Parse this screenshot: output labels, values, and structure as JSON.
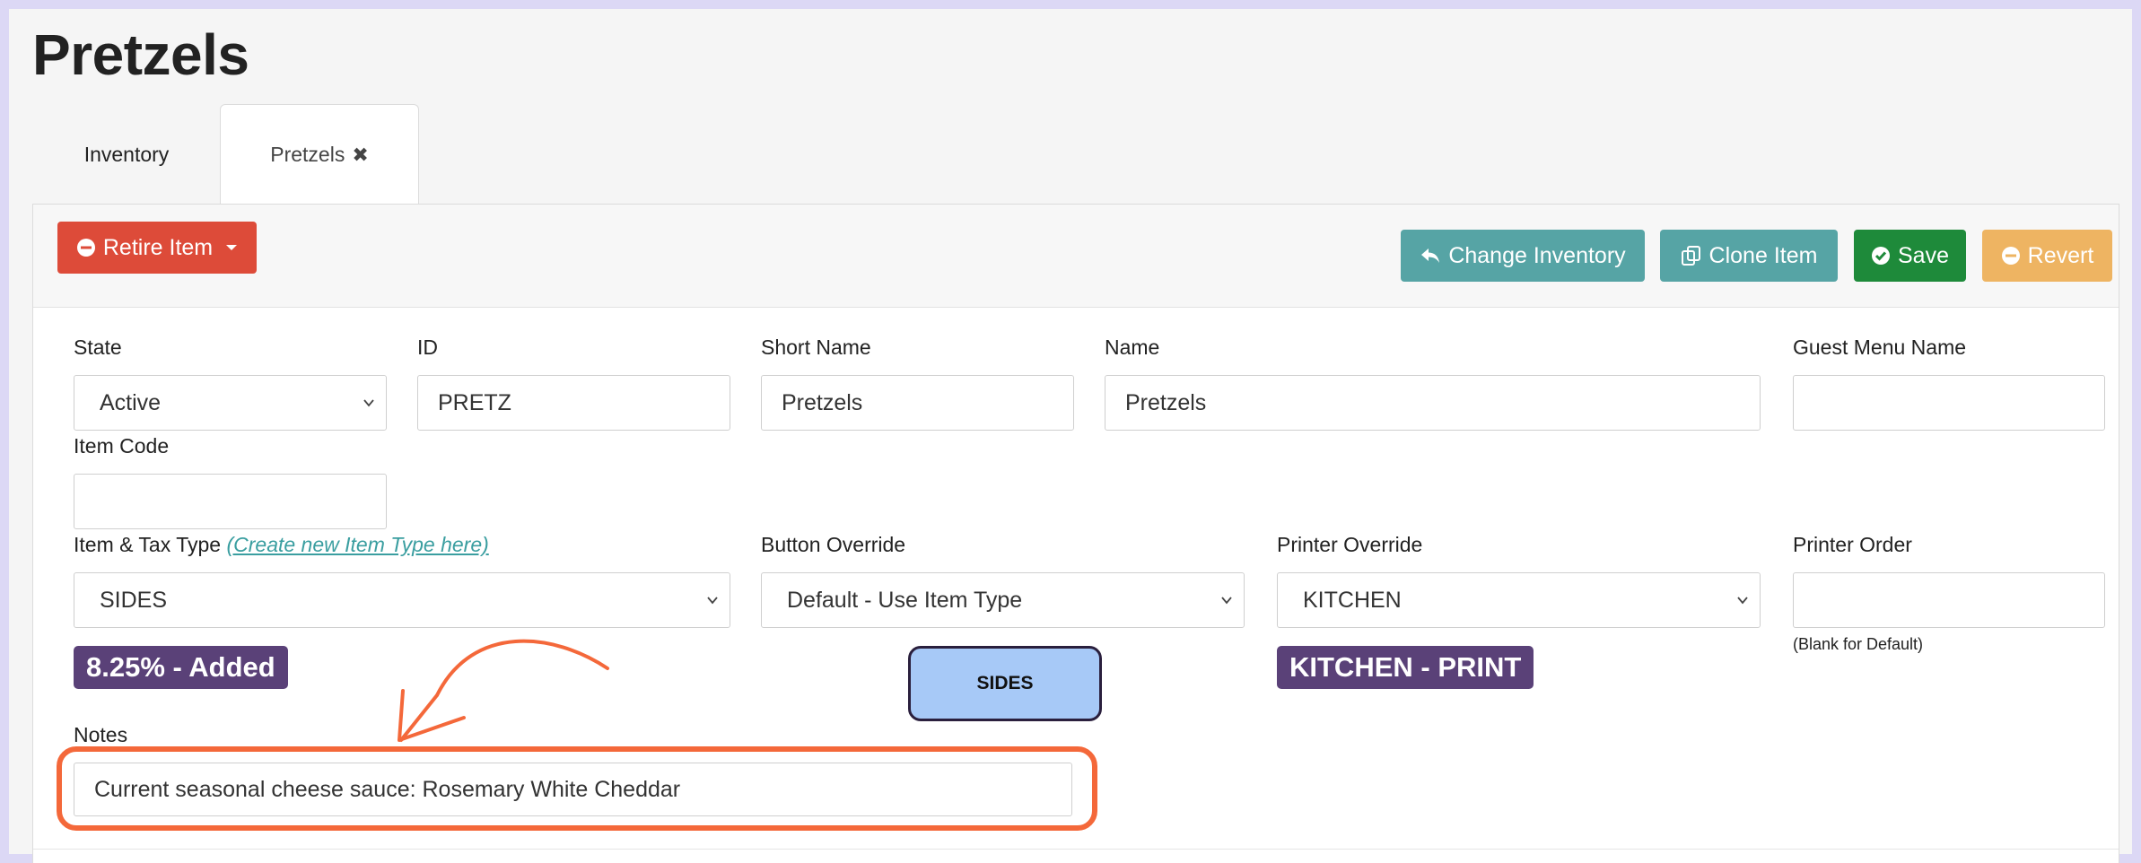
{
  "page": {
    "title": "Pretzels"
  },
  "tabs": [
    {
      "label": "Inventory"
    },
    {
      "label": "Pretzels",
      "close_glyph": "✖"
    }
  ],
  "toolbar": {
    "retire_label": "Retire Item",
    "change_inventory_label": "Change Inventory",
    "clone_label": "Clone Item",
    "save_label": "Save",
    "revert_label": "Revert"
  },
  "form": {
    "state": {
      "label": "State",
      "value": "Active"
    },
    "id": {
      "label": "ID",
      "value": "PRETZ"
    },
    "short_name": {
      "label": "Short Name",
      "value": "Pretzels"
    },
    "name": {
      "label": "Name",
      "value": "Pretzels"
    },
    "guest_menu_name": {
      "label": "Guest Menu Name",
      "value": ""
    },
    "item_code": {
      "label": "Item Code",
      "value": ""
    },
    "item_tax_type": {
      "label": "Item & Tax Type",
      "link": "(Create new Item Type here)",
      "value": "SIDES",
      "badge": "8.25% - Added"
    },
    "button_override": {
      "label": "Button Override",
      "value": "Default - Use Item Type",
      "preview": "SIDES"
    },
    "printer_override": {
      "label": "Printer Override",
      "value": "KITCHEN",
      "badge": "KITCHEN - PRINT"
    },
    "printer_order": {
      "label": "Printer Order",
      "value": "",
      "hint": "(Blank for Default)"
    },
    "notes": {
      "label": "Notes",
      "value": "Current seasonal cheese sauce: Rosemary White Cheddar"
    }
  },
  "colors": {
    "danger": "#dd4b39",
    "teal": "#56a4a5",
    "success": "#1e8a3a",
    "warning": "#eeb462",
    "badge": "#5a4178",
    "annotation": "#f4683a",
    "button_preview": "#a7c9f7"
  },
  "icons": {
    "retire": "minus-circle-icon",
    "change_inventory": "reply-icon",
    "clone": "clone-icon",
    "save": "check-circle-icon",
    "revert": "minus-circle-icon",
    "tab_close": "close-icon",
    "select": "chevron-down-icon"
  }
}
